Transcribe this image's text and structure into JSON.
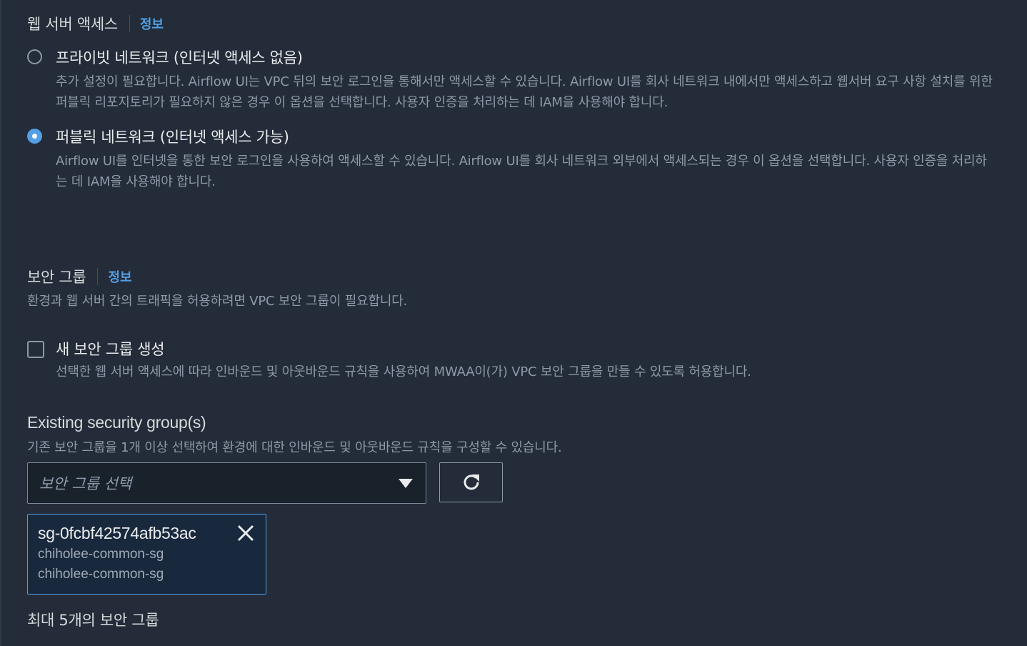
{
  "web_server_access": {
    "heading": "웹 서버 액세스",
    "info_link": "정보",
    "options": [
      {
        "label": "프라이빗 네트워크 (인터넷 액세스 없음)",
        "description": "추가 설정이 필요합니다. Airflow UI는 VPC 뒤의 보안 로그인을 통해서만 액세스할 수 있습니다. Airflow UI를 회사 네트워크 내에서만 액세스하고 웹서버 요구 사항 설치를 위한 퍼블릭 리포지토리가 필요하지 않은 경우 이 옵션을 선택합니다. 사용자 인증을 처리하는 데 IAM을 사용해야 합니다.",
        "selected": false
      },
      {
        "label": "퍼블릭 네트워크 (인터넷 액세스 가능)",
        "description": "Airflow UI를 인터넷을 통한 보안 로그인을 사용하여 액세스할 수 있습니다. Airflow UI를 회사 네트워크 외부에서 액세스되는 경우 이 옵션을 선택합니다. 사용자 인증을 처리하는 데 IAM을 사용해야 합니다.",
        "selected": true
      }
    ]
  },
  "security_group": {
    "heading": "보안 그룹",
    "info_link": "정보",
    "description": "환경과 웹 서버 간의 트래픽을 허용하려면 VPC 보안 그룹이 필요합니다.",
    "create_new": {
      "label": "새 보안 그룹 생성",
      "description": "선택한 웹 서버 액세스에 따라 인바운드 및 아웃바운드 규칙을 사용하여 MWAA이(가) VPC 보안 그룹을 만들 수 있도록 허용합니다.",
      "checked": false
    },
    "existing": {
      "heading": "Existing security group(s)",
      "description": "기존 보안 그룹을 1개 이상 선택하여 환경에 대한 인바운드 및 아웃바운드 규칙을 구성할 수 있습니다.",
      "select_placeholder": "보안 그룹 선택",
      "selected_tokens": [
        {
          "id": "sg-0fcbf42574afb53ac",
          "name": "chiholee-common-sg",
          "description": "chiholee-common-sg"
        }
      ],
      "max_note": "최대 5개의 보안 그룹"
    }
  },
  "icons": {
    "dropdown": "caret-down-icon",
    "refresh": "refresh-icon",
    "remove": "close-icon"
  },
  "colors": {
    "background": "#232c38",
    "accent": "#539fe5",
    "text_primary": "#e9ebed",
    "text_secondary": "#8d99a8"
  }
}
